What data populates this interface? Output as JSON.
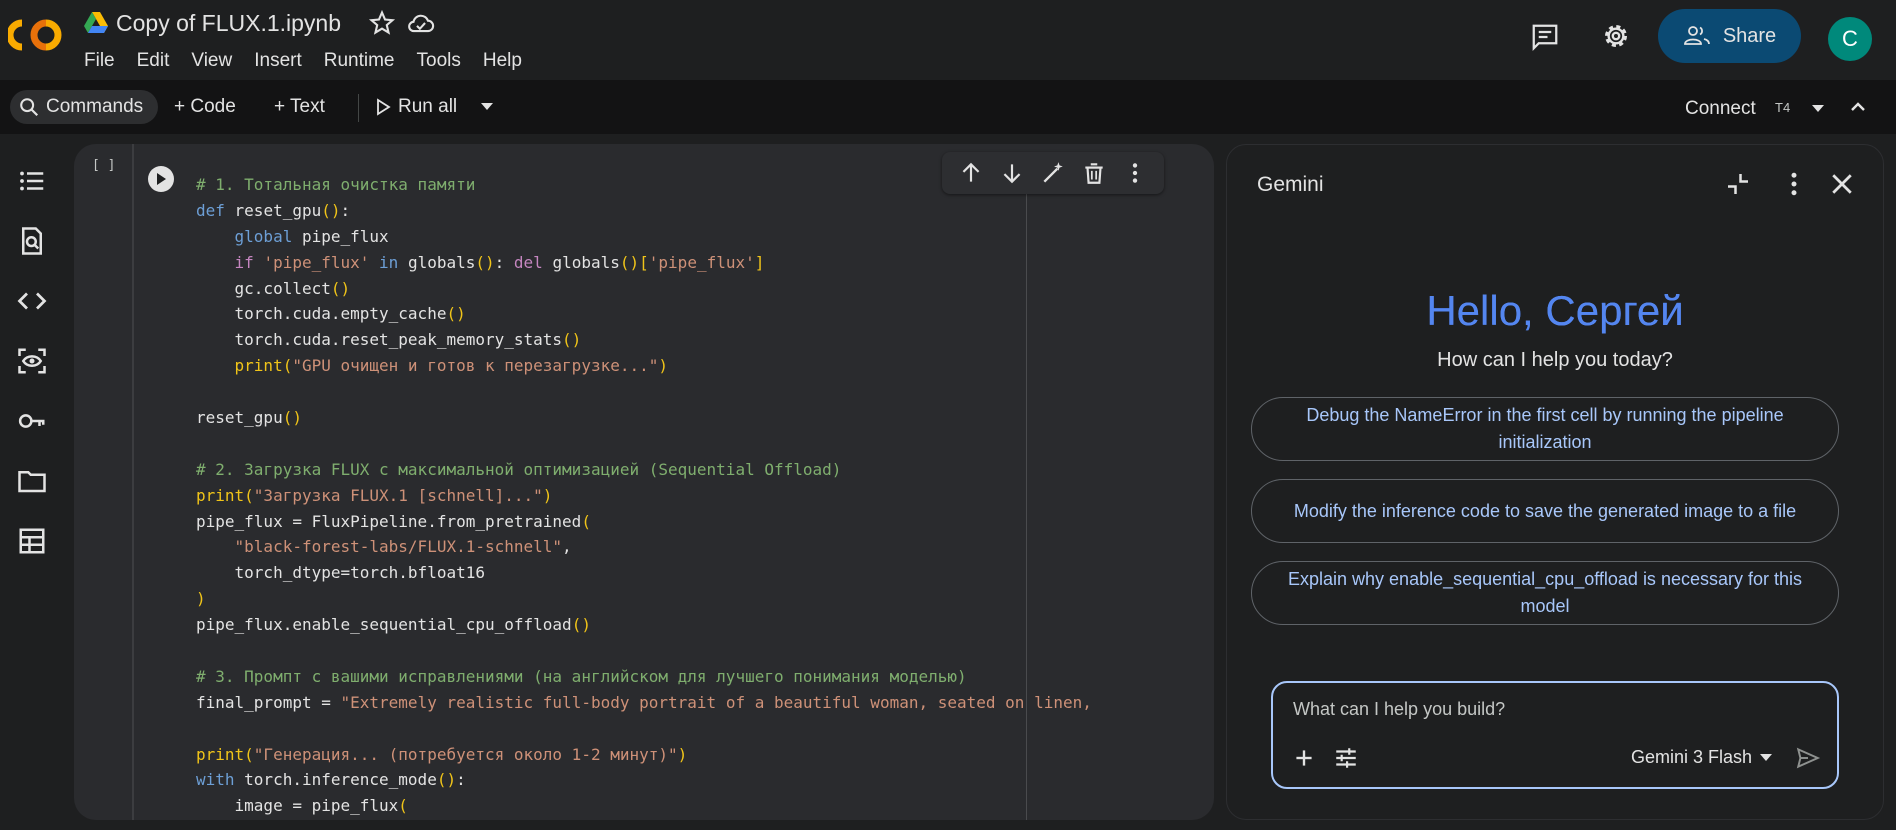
{
  "header": {
    "logo_text": "CO",
    "file_title": "Copy of FLUX.1.ipynb",
    "menu": [
      "File",
      "Edit",
      "View",
      "Insert",
      "Runtime",
      "Tools",
      "Help"
    ],
    "share_label": "Share",
    "avatar_letter": "C"
  },
  "toolbar": {
    "commands_label": "Commands",
    "code_label": "+ Code",
    "text_label": "+ Text",
    "run_all_label": "Run all",
    "connect_label": "Connect",
    "runtime_badge": "T4"
  },
  "sidebar": {
    "icons": [
      "table-of-contents-icon",
      "find-icon",
      "code-snippets-icon",
      "variables-icon",
      "secrets-key-icon",
      "files-folder-icon",
      "data-table-icon"
    ]
  },
  "cell": {
    "execution_count": "[ ]",
    "code_lines": [
      "# 1. Тотальная очистка памяти",
      "def reset_gpu():",
      "    global pipe_flux",
      "    if 'pipe_flux' in globals(): del globals()['pipe_flux']",
      "    gc.collect()",
      "    torch.cuda.empty_cache()",
      "    torch.cuda.reset_peak_memory_stats()",
      "    print(\"GPU очищен и готов к перезагрузке...\")",
      "",
      "reset_gpu()",
      "",
      "# 2. Загрузка FLUX с максимальной оптимизацией (Sequential Offload)",
      "print(\"Загрузка FLUX.1 [schnell]...\")",
      "pipe_flux = FluxPipeline.from_pretrained(",
      "    \"black-forest-labs/FLUX.1-schnell\",",
      "    torch_dtype=torch.bfloat16",
      ")",
      "pipe_flux.enable_sequential_cpu_offload()",
      "",
      "# 3. Промпт с вашими исправлениями (на английском для лучшего понимания моделью)",
      "final_prompt = \"Extremely realistic full-body portrait of a beautiful woman, seated on linen,",
      "",
      "print(\"Генерация... (потребуется около 1-2 минут)\")",
      "with torch.inference_mode():",
      "    image = pipe_flux("
    ]
  },
  "gemini": {
    "title": "Gemini",
    "greeting": "Hello, Сергей",
    "subgreeting": "How can I help you today?",
    "suggestions": [
      "Debug the NameError in the first cell by running the pipeline initialization",
      "Modify the inference code to save the generated image to a file",
      "Explain why enable_sequential_cpu_offload is necessary for this model"
    ],
    "input_placeholder": "What can I help you build?",
    "model_name": "Gemini 3 Flash"
  },
  "colors": {
    "accent_blue": "#a8c7fa",
    "share_bg": "#0b4a73",
    "avatar_bg": "#00897b",
    "logo_orange": "#f9ab00"
  }
}
